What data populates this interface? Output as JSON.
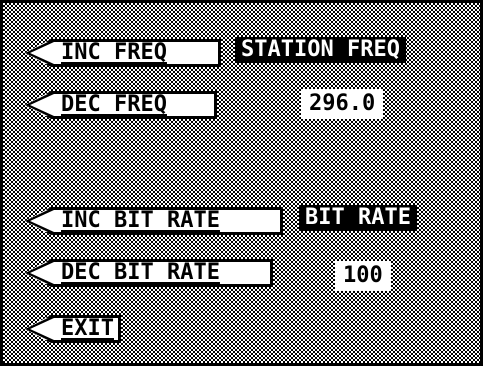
{
  "menu": {
    "inc_freq": "INC FREQ",
    "dec_freq": "DEC FREQ",
    "inc_bit_rate": "INC BIT RATE",
    "dec_bit_rate": "DEC BIT RATE",
    "exit": "EXIT"
  },
  "station_freq": {
    "label": "STATION FREQ",
    "value": "296.0"
  },
  "bit_rate": {
    "label": "BIT RATE",
    "value": "100"
  },
  "icons": {
    "softkey_arrow": "left-arrow-icon"
  },
  "colors": {
    "foreground": "#000000",
    "background": "#ffffff"
  }
}
